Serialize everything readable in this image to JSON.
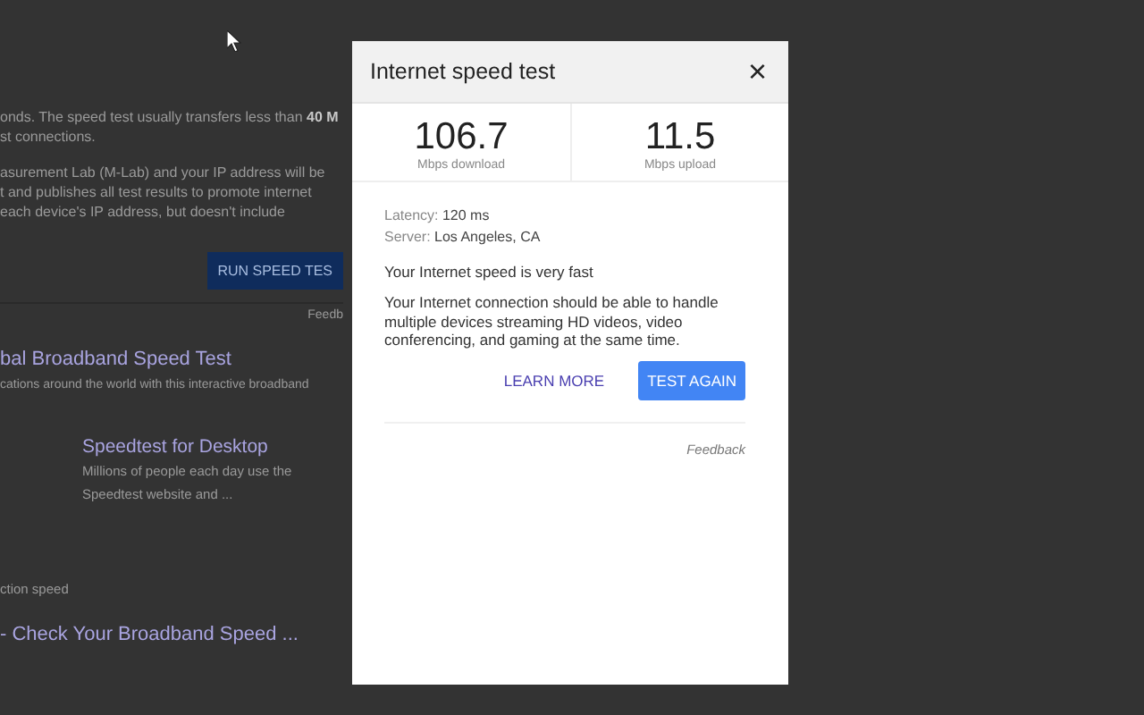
{
  "background_page": {
    "paragraph_1": [
      "onds. The speed test usually transfers less than **40 M**",
      "st connections."
    ],
    "paragraph_2": [
      "asurement Lab (M-Lab) and your IP address will be",
      "t and publishes all test results to promote internet",
      "each device's IP address, but doesn't include"
    ],
    "run_button": "RUN SPEED TES",
    "feedback": "Feedb",
    "result_title": "bal Broadband Speed Test",
    "result_snippet": "cations around the world with this interactive broadband",
    "card_title": "Speedtest for Desktop",
    "card_snippet": [
      "Millions of people each day use the",
      "Speedtest website and ..."
    ],
    "related_label": "ction speed",
    "related_title": "- Check Your Broadband Speed ..."
  },
  "dialog": {
    "title": "Internet speed test",
    "close": "×",
    "stats": [
      {
        "value": "106.7",
        "label": "Mbps download"
      },
      {
        "value": "11.5",
        "label": "Mbps upload"
      }
    ],
    "details": [
      {
        "label": "Latency:",
        "value": "120 ms"
      },
      {
        "label": "Server:",
        "value": "Los Angeles, CA"
      }
    ],
    "verdict": "Your Internet speed is very fast",
    "description": "Your Internet connection should be able to handle multiple devices streaming HD videos, video conferencing, and gaming at the same time.",
    "buttons": [
      {
        "label": "LEARN MORE",
        "kind": "text"
      },
      {
        "label": "TEST AGAIN",
        "kind": "primary"
      }
    ],
    "feedback": "Feedback"
  }
}
